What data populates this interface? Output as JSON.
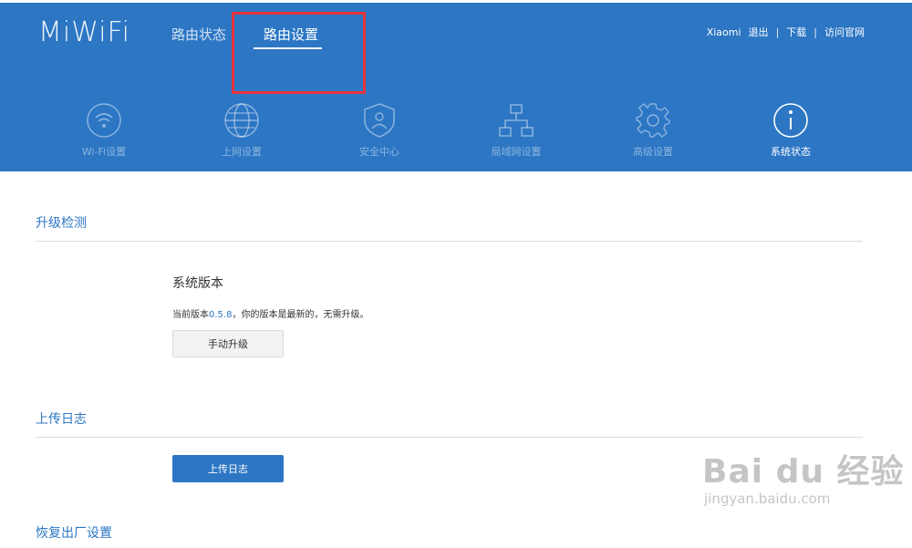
{
  "header": {
    "logo": "MiWiFi",
    "tabs": [
      {
        "label": "路由状态",
        "active": false
      },
      {
        "label": "路由设置",
        "active": true
      }
    ],
    "links": {
      "user": "Xiaomi",
      "logout": "退出",
      "sep1": "|",
      "download": "下载",
      "sep2": "|",
      "website": "访问官网"
    }
  },
  "icon_nav": [
    {
      "label": "Wi-Fi设置",
      "icon": "wifi-icon",
      "active": false
    },
    {
      "label": "上网设置",
      "icon": "globe-icon",
      "active": false
    },
    {
      "label": "安全中心",
      "icon": "shield-icon",
      "active": false
    },
    {
      "label": "局域网设置",
      "icon": "network-icon",
      "active": false
    },
    {
      "label": "高级设置",
      "icon": "gear-icon",
      "active": false
    },
    {
      "label": "系统状态",
      "icon": "info-icon",
      "active": true
    }
  ],
  "upgrade": {
    "title": "升级检测",
    "subtitle": "系统版本",
    "version_prefix": "当前版本",
    "version": "0.5.8",
    "version_suffix": "，你的版本是最新的，无需升级。",
    "button": "手动升级"
  },
  "upload_log": {
    "title": "上传日志",
    "button": "上传日志"
  },
  "factory_reset": {
    "title": "恢复出厂设置"
  },
  "watermark": {
    "main": "Bai du 经验",
    "sub": "jingyan.baidu.com"
  },
  "colors": {
    "brand_blue": "#2c76c4",
    "highlight_red": "#e8343c"
  }
}
